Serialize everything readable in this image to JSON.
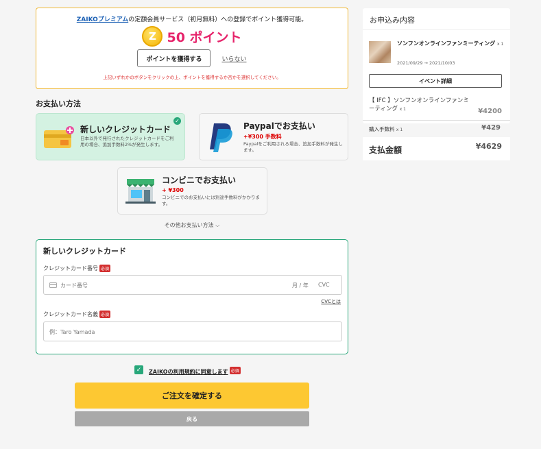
{
  "points": {
    "brand_link": "ZAIKOプレミアム",
    "intro_rest": "の定額会員サービス（初月無料）への登録でポイント獲得可能。",
    "coin_letter": "Z",
    "value": "50 ポイント",
    "earn_button": "ポイントを獲得する",
    "decline_link": "いらない",
    "note": "上記いずれかのボタンをクリックの上、ポイントを獲得するか否かを選択してください。"
  },
  "payment": {
    "section_title": "お支払い方法",
    "methods": [
      {
        "title": "新しいクレジットカード",
        "desc": "日本以外で発行されたクレジットカードをご利用の場合、追加手数料2%が発生します。",
        "selected": true
      },
      {
        "title": "Paypalでお支払い",
        "fee": "+¥300 手数料",
        "desc": "Paypalをご利用される場合、追加手数料が発生します。"
      },
      {
        "title": "コンビニでお支払い",
        "fee": "+ ¥300",
        "desc": "コンビニでのお支払いには別途手数料がかかります。"
      }
    ],
    "other_methods": "その他お支払い方法 ⌵"
  },
  "credit_card": {
    "title": "新しいクレジットカード",
    "number_label": "クレジットカード番号",
    "number_placeholder": "カード番号",
    "expiry_placeholder": "月 / 年",
    "cvc_placeholder": "CVC",
    "cvc_help": "CVCとは",
    "name_label": "クレジットカード名義",
    "name_placeholder": "例：Taro Yamada",
    "required_badge": "必須"
  },
  "terms": {
    "text": "ZAIKOの利用規約に同意します",
    "required_badge": "必須"
  },
  "actions": {
    "confirm": "ご注文を確定する",
    "back": "戻る"
  },
  "order": {
    "header": "お申込み内容",
    "event_name": "ソンフンオンラインファンミーティング",
    "event_qty": "x 1",
    "event_dates": "2021/09/29 → 2021/10/03",
    "detail_button": "イベント詳細",
    "item_name": "【 IFC 】ソンフンオンラインファンミーティング",
    "item_qty": "x 1",
    "item_price": "¥4200",
    "fee_label": "購入手数料",
    "fee_qty": "x 1",
    "fee_price": "¥429",
    "total_label": "支払金額",
    "total_price": "¥4629"
  },
  "colors": {
    "accent_green": "#28a77a",
    "points_pink": "#e6246b",
    "confirm_yellow": "#fdc832",
    "border_orange": "#f0b731"
  }
}
